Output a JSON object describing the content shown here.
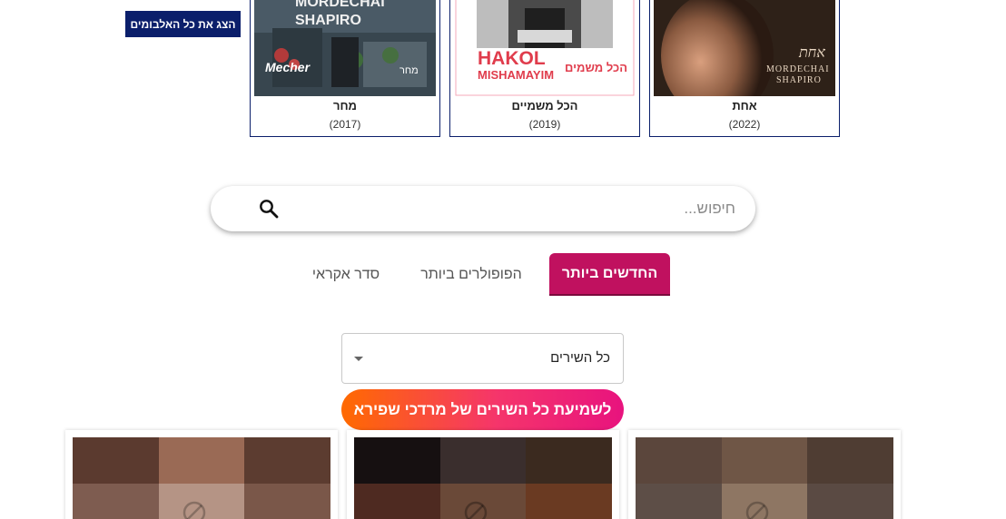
{
  "albums_section": {
    "show_all_label": "הצג את כל האלבומים",
    "albums": [
      {
        "name": "אחת",
        "year": "(2022)",
        "cover_text_main": "אחת",
        "cover_text_artist": "MORDECHAI",
        "cover_text_artist2": "SHAPIRO"
      },
      {
        "name": "הכל משמיים",
        "year": "(2019)",
        "cover_text_main": "HAKOL",
        "cover_text_sub": "MISHAMAYIM",
        "cover_text_heb": "הכל משמים"
      },
      {
        "name": "מחר",
        "year": "(2017)",
        "cover_text_artist": "MORDECHAI",
        "cover_text_artist2": "SHAPIRO",
        "cover_text_main": "Mecher",
        "cover_text_heb": "מחר"
      }
    ]
  },
  "search": {
    "placeholder": "חיפוש..."
  },
  "tabs": [
    {
      "label": "החדשים ביותר",
      "active": true
    },
    {
      "label": "הפופולרים ביותר",
      "active": false
    },
    {
      "label": "סדר אקראי",
      "active": false
    }
  ],
  "filter": {
    "selected": "כל השירים"
  },
  "listen_all": {
    "label": "לשמיעת כל השירים של מרדכי שפירא"
  },
  "colors": {
    "album_border": "#0b1f6b",
    "active_tab": "#c0115f",
    "cta_gradient_start": "#ff6a00",
    "cta_gradient_end": "#e8137e"
  },
  "icons": {
    "search": "search-icon",
    "dropdown": "chevron-down-icon",
    "placeholder": "no-image-icon"
  }
}
